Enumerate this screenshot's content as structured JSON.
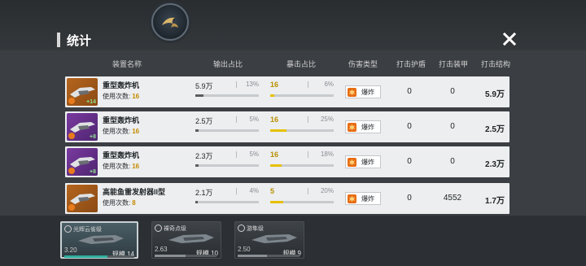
{
  "title": "统计",
  "headers": {
    "equipment": "装置名称",
    "output": "输出占比",
    "crit": "暴击占比",
    "damage_type": "伤害类型",
    "shield": "打击护盾",
    "armor": "打击装甲",
    "structure": "打击结构"
  },
  "usage_label": "使用次数:",
  "rows": [
    {
      "name": "重型轰炸机",
      "uses": "16",
      "level": "+14",
      "rarity": "orange",
      "output_value": "5.9万",
      "output_pct": "13%",
      "output_fill": 0.13,
      "crit_value": "16",
      "crit_pct": "6%",
      "crit_fill": 0.06,
      "damage_type": "爆炸",
      "shield": "0",
      "armor": "0",
      "structure": "5.9万"
    },
    {
      "name": "重型轰炸机",
      "uses": "16",
      "level": "+8",
      "rarity": "purple",
      "output_value": "2.5万",
      "output_pct": "5%",
      "output_fill": 0.05,
      "crit_value": "16",
      "crit_pct": "25%",
      "crit_fill": 0.25,
      "damage_type": "爆炸",
      "shield": "0",
      "armor": "0",
      "structure": "2.5万"
    },
    {
      "name": "重型轰炸机",
      "uses": "16",
      "level": "+8",
      "rarity": "purple",
      "output_value": "2.3万",
      "output_pct": "5%",
      "output_fill": 0.05,
      "crit_value": "16",
      "crit_pct": "18%",
      "crit_fill": 0.18,
      "damage_type": "爆炸",
      "shield": "0",
      "armor": "0",
      "structure": "2.3万"
    },
    {
      "name": "高能鱼雷发射器II型",
      "uses": "8",
      "level": "",
      "rarity": "orange",
      "output_value": "2.1万",
      "output_pct": "4%",
      "output_fill": 0.04,
      "crit_value": "5",
      "crit_pct": "20%",
      "crit_fill": 0.2,
      "damage_type": "爆炸",
      "shield": "0",
      "armor": "4552",
      "structure": "1.7万"
    }
  ],
  "ships": [
    {
      "name": "光辉云雀级",
      "rating": "3.20",
      "scale": "规模.14",
      "selected": true,
      "fill": 0.62
    },
    {
      "name": "裸奇点级",
      "rating": "2.63",
      "scale": "规模.10",
      "selected": false,
      "fill": 0.5
    },
    {
      "name": "游隼级",
      "rating": "2.50",
      "scale": "规模.9",
      "selected": false,
      "fill": 0.48
    }
  ],
  "colors": {
    "accent_yellow": "#e6c000",
    "explosive": "#e66b12",
    "selected_bar": "#2fae9e"
  },
  "icons": {
    "emblem": "bird-emblem-icon",
    "close": "close-icon",
    "damage": "explosion-icon"
  }
}
